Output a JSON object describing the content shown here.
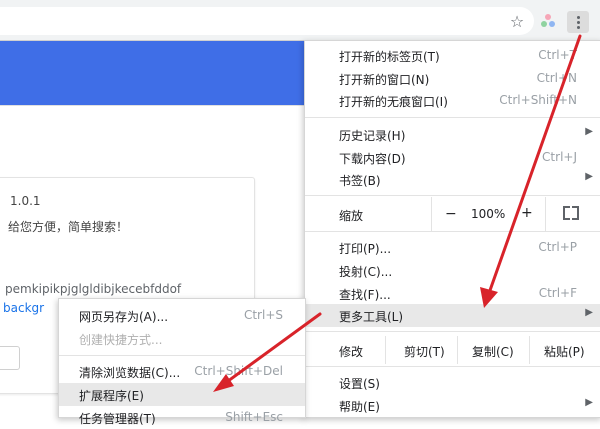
{
  "toolbar": {
    "star_icon": "star-icon",
    "extension_icon": "extension-icon",
    "menu_icon": "three-dot-menu-icon"
  },
  "page": {
    "version": "1.0.1",
    "description": "，给您方便，简单搜索！",
    "extension_id": "pemkipikpjglgldibjkecebfddof",
    "link_text": "backgr"
  },
  "menu": {
    "new_tab": {
      "label": "打开新的标签页(T)",
      "shortcut": "Ctrl+T"
    },
    "new_window": {
      "label": "打开新的窗口(N)",
      "shortcut": "Ctrl+N"
    },
    "incognito": {
      "label": "打开新的无痕窗口(I)",
      "shortcut": "Ctrl+Shift+N"
    },
    "history": {
      "label": "历史记录(H)"
    },
    "downloads": {
      "label": "下载内容(D)",
      "shortcut": "Ctrl+J"
    },
    "bookmarks": {
      "label": "书签(B)"
    },
    "zoom": {
      "label": "缩放",
      "minus": "−",
      "value": "100%",
      "plus": "+"
    },
    "print": {
      "label": "打印(P)...",
      "shortcut": "Ctrl+P"
    },
    "cast": {
      "label": "投射(C)..."
    },
    "find": {
      "label": "查找(F)...",
      "shortcut": "Ctrl+F"
    },
    "more_tools": {
      "label": "更多工具(L)"
    },
    "edit": {
      "label": "修改",
      "cut": "剪切(T)",
      "copy": "复制(C)",
      "paste": "粘贴(P)"
    },
    "settings": {
      "label": "设置(S)"
    },
    "help": {
      "label": "帮助(E)"
    }
  },
  "submenu": {
    "save_page": {
      "label": "网页另存为(A)...",
      "shortcut": "Ctrl+S"
    },
    "create_shortcut": {
      "label": "创建快捷方式..."
    },
    "clear_data": {
      "label": "清除浏览数据(C)...",
      "shortcut": "Ctrl+Shift+Del"
    },
    "extensions": {
      "label": "扩展程序(E)"
    },
    "task_manager": {
      "label": "任务管理器(T)",
      "shortcut": "Shift+Esc"
    }
  },
  "colors": {
    "accent_blue": "#3f6ee7",
    "arrow_red": "#d8232a",
    "highlight": "#e8e8e8"
  }
}
